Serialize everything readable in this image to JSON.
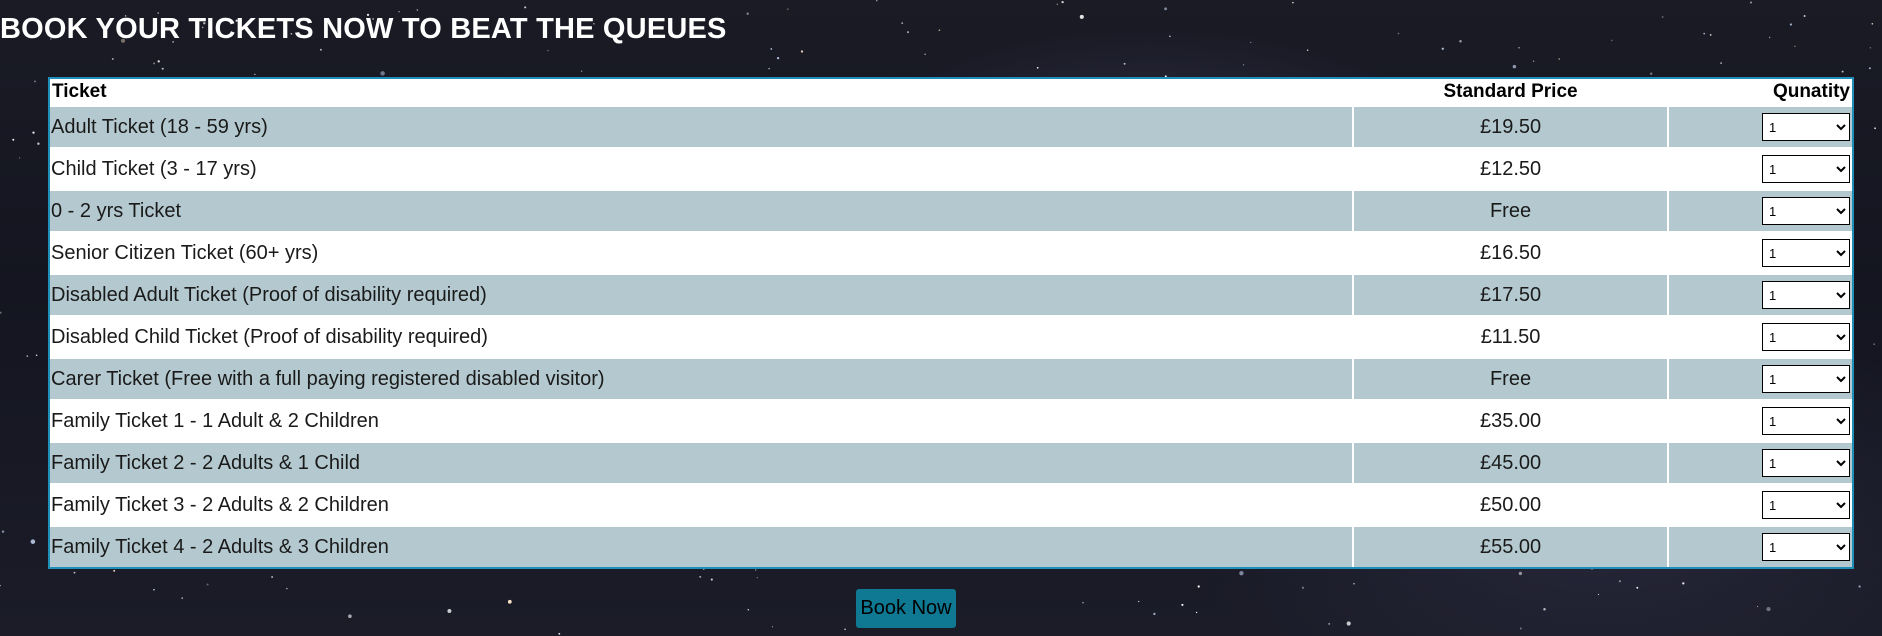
{
  "heading": "BOOK YOUR TICKETS NOW TO BEAT THE QUEUES",
  "table": {
    "headers": {
      "ticket": "Ticket",
      "price": "Standard Price",
      "quantity": "Qunatity"
    },
    "rows": [
      {
        "ticket": "Adult Ticket (18 - 59 yrs)",
        "price": "£19.50",
        "quantity": "1"
      },
      {
        "ticket": "Child Ticket (3 - 17 yrs)",
        "price": "£12.50",
        "quantity": "1"
      },
      {
        "ticket": "0 - 2 yrs Ticket",
        "price": "Free",
        "quantity": "1"
      },
      {
        "ticket": "Senior Citizen Ticket (60+ yrs)",
        "price": "£16.50",
        "quantity": "1"
      },
      {
        "ticket": "Disabled Adult Ticket (Proof of disability required)",
        "price": "£17.50",
        "quantity": "1"
      },
      {
        "ticket": "Disabled Child Ticket (Proof of disability required)",
        "price": "£11.50",
        "quantity": "1"
      },
      {
        "ticket": "Carer Ticket (Free with a full paying registered disabled visitor)",
        "price": "Free",
        "quantity": "1"
      },
      {
        "ticket": "Family Ticket 1 - 1 Adult & 2 Children",
        "price": "£35.00",
        "quantity": "1"
      },
      {
        "ticket": "Family Ticket 2 - 2 Adults & 1 Child",
        "price": "£45.00",
        "quantity": "1"
      },
      {
        "ticket": "Family Ticket 3 - 2 Adults & 2 Children",
        "price": "£50.00",
        "quantity": "1"
      },
      {
        "ticket": "Family Ticket 4 - 2 Adults & 3 Children",
        "price": "£55.00",
        "quantity": "1"
      }
    ]
  },
  "book_button": {
    "label": "Book Now"
  },
  "colors": {
    "table_border": "#1d8fb8",
    "row_alt": "#b4c9cf",
    "button": "#0f7892"
  }
}
